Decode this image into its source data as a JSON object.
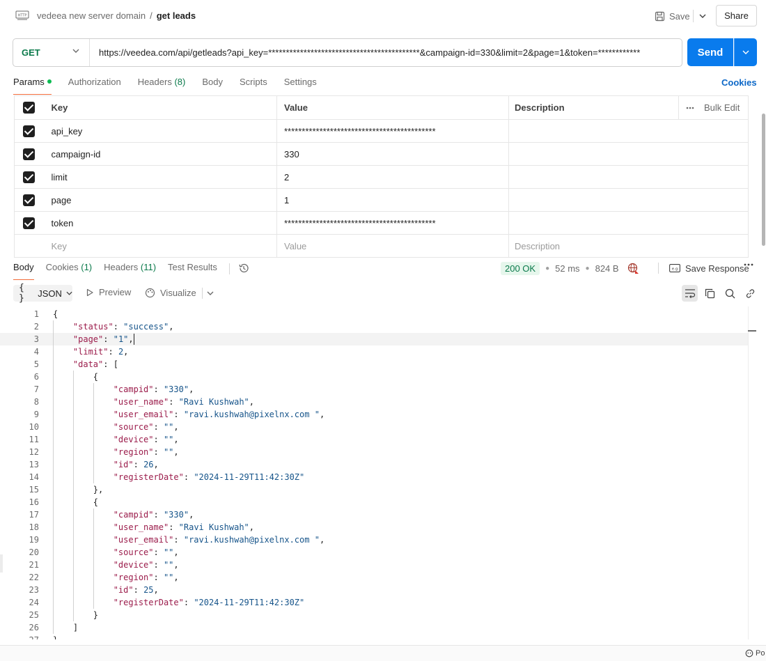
{
  "header": {
    "collection": "vedeea new server domain",
    "separator": "/",
    "request_name": "get leads",
    "save_label": "Save",
    "share_label": "Share"
  },
  "request": {
    "method": "GET",
    "url": "https://veedea.com/api/getleads?api_key=*******************************************&campaign-id=330&limit=2&page=1&token=************",
    "send_label": "Send"
  },
  "request_tabs": {
    "params": "Params",
    "authorization": "Authorization",
    "headers": "Headers",
    "headers_count": "(8)",
    "body": "Body",
    "scripts": "Scripts",
    "settings": "Settings",
    "cookies": "Cookies"
  },
  "params": {
    "headers": {
      "key": "Key",
      "value": "Value",
      "description": "Description",
      "bulk_edit": "Bulk Edit"
    },
    "rows": [
      {
        "key": "api_key",
        "value": "*******************************************"
      },
      {
        "key": "campaign-id",
        "value": "330"
      },
      {
        "key": "limit",
        "value": "2"
      },
      {
        "key": "page",
        "value": "1"
      },
      {
        "key": "token",
        "value": "*******************************************"
      }
    ],
    "placeholders": {
      "key": "Key",
      "value": "Value",
      "description": "Description"
    }
  },
  "response_tabs": {
    "body": "Body",
    "cookies": "Cookies",
    "cookies_count": "(1)",
    "headers": "Headers",
    "headers_count": "(11)",
    "test_results": "Test Results"
  },
  "response_meta": {
    "status": "200 OK",
    "time": "52 ms",
    "size": "824 B",
    "save_response": "Save Response"
  },
  "body_toolbar": {
    "format": "JSON",
    "preview": "Preview",
    "visualize": "Visualize"
  },
  "code": [
    "{",
    "    \"status\": \"success\",",
    "    \"page\": \"1\",",
    "    \"limit\": 2,",
    "    \"data\": [",
    "        {",
    "            \"campid\": \"330\",",
    "            \"user_name\": \"Ravi Kushwah\",",
    "            \"user_email\": \"ravi.kushwah@pixelnx.com \",",
    "            \"source\": \"\",",
    "            \"device\": \"\",",
    "            \"region\": \"\",",
    "            \"id\": 26,",
    "            \"registerDate\": \"2024-11-29T11:42:30Z\"",
    "        },",
    "        {",
    "            \"campid\": \"330\",",
    "            \"user_name\": \"Ravi Kushwah\",",
    "            \"user_email\": \"ravi.kushwah@pixelnx.com \",",
    "            \"source\": \"\",",
    "            \"device\": \"\",",
    "            \"region\": \"\",",
    "            \"id\": 25,",
    "            \"registerDate\": \"2024-11-29T11:42:30Z\"",
    "        }",
    "    ]",
    "}"
  ],
  "footer": {
    "label": "Po"
  },
  "colors": {
    "accent": "#097bed",
    "method_get": "#0b7a4b",
    "status_ok": "#0b7a4b",
    "tab_indicator": "#f26b3a"
  }
}
